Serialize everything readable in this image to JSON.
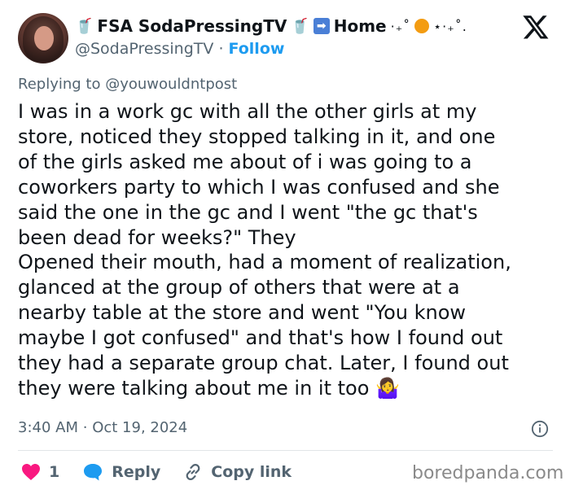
{
  "author": {
    "display_name": "FSA SodaPressingTV",
    "display_emoji": "🥤",
    "home_label": "Home",
    "handle": "@SodaPressingTV",
    "separator": "·",
    "follow_label": "Follow"
  },
  "reply": {
    "label": "Replying to",
    "target": "@youwouldntpost"
  },
  "post": {
    "text": "I was in a work gc with all the other girls at my\nstore, noticed they stopped talking in it, and one\nof the girls asked me about of i was going to a\ncoworkers party to which I was confused and she\nsaid the one in the gc and I went \"the gc that's\nbeen dead for weeks?\" They\nOpened their mouth, had a moment of realization,\nglanced at the group of others that were at a\nnearby table at the store and went \"You know\nmaybe I got confused\" and that's how I found out\nthey had a separate group chat. Later, I found out\nthey were talking about me in it too 🤷‍♀️",
    "time": "3:40 AM",
    "date": "Oct 19, 2024"
  },
  "actions": {
    "like_count": "1",
    "reply_label": "Reply",
    "copy_link_label": "Copy link"
  },
  "watermark": "boredpanda.com",
  "colors": {
    "accent": "#1d9bf0",
    "like": "#f91880",
    "muted": "#536471"
  }
}
